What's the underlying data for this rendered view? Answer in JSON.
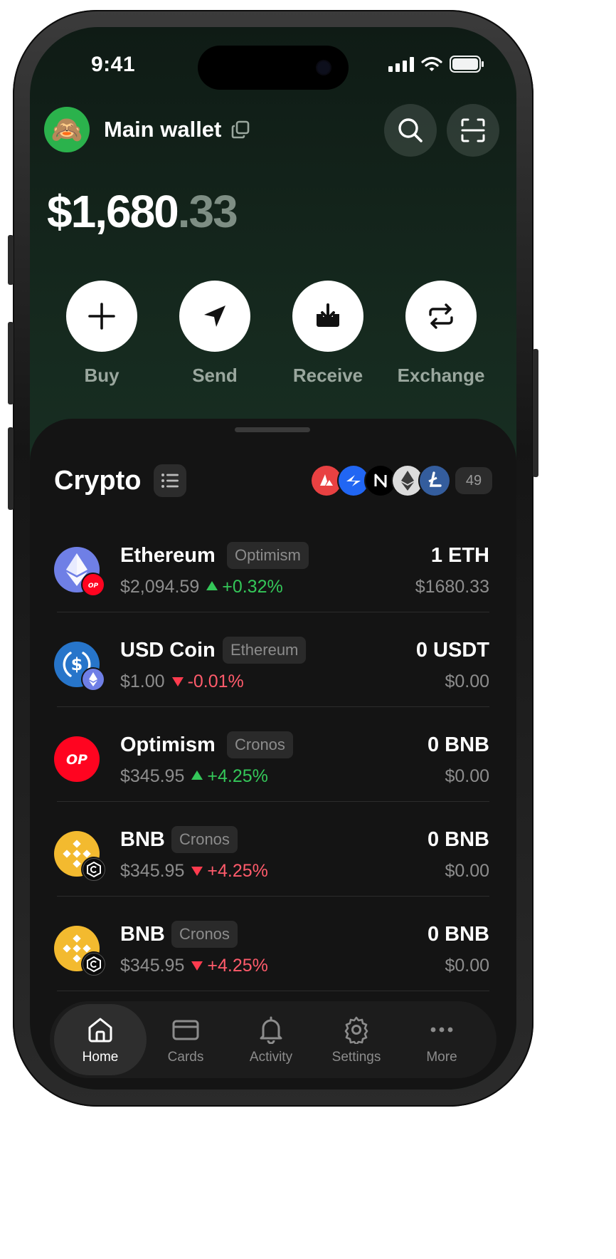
{
  "status_bar": {
    "time": "9:41"
  },
  "header": {
    "avatar_emoji": "🙈",
    "wallet_name": "Main wallet",
    "icons": [
      "copy-icon",
      "search-icon",
      "scan-icon"
    ]
  },
  "balance": {
    "whole": "$1,680",
    "cents": ".33"
  },
  "actions": [
    {
      "label": "Buy",
      "icon": "plus-icon"
    },
    {
      "label": "Send",
      "icon": "send-icon"
    },
    {
      "label": "Receive",
      "icon": "receive-icon"
    },
    {
      "label": "Exchange",
      "icon": "exchange-icon"
    }
  ],
  "crypto": {
    "title": "Crypto",
    "chain_icons": [
      "avalanche-icon",
      "arbitrum-icon",
      "near-icon",
      "ethereum-icon",
      "litecoin-icon"
    ],
    "chain_count": "49"
  },
  "tokens": [
    {
      "name": "Ethereum",
      "network": "Optimism",
      "price": "$2,094.59",
      "direction": "up",
      "change": "+0.32%",
      "amount": "1 ETH",
      "fiat": "$1680.33"
    },
    {
      "name": "USD Coin",
      "network": "Ethereum",
      "price": "$1.00",
      "direction": "down",
      "change": "-0.01%",
      "amount": "0 USDT",
      "fiat": "$0.00"
    },
    {
      "name": "Optimism",
      "network": "Cronos",
      "price": "$345.95",
      "direction": "up",
      "change": "+4.25%",
      "amount": "0 BNB",
      "fiat": "$0.00"
    },
    {
      "name": "BNB",
      "network": "Cronos",
      "price": "$345.95",
      "direction": "down",
      "change": "+4.25%",
      "amount": "0 BNB",
      "fiat": "$0.00"
    },
    {
      "name": "BNB",
      "network": "Cronos",
      "price": "$345.95",
      "direction": "down",
      "change": "+4.25%",
      "amount": "0 BNB",
      "fiat": "$0.00"
    }
  ],
  "tabbar": [
    {
      "label": "Home",
      "icon": "home-icon",
      "active": true
    },
    {
      "label": "Cards",
      "icon": "card-icon",
      "active": false
    },
    {
      "label": "Activity",
      "icon": "bell-icon",
      "active": false
    },
    {
      "label": "Settings",
      "icon": "gear-icon",
      "active": false
    },
    {
      "label": "More",
      "icon": "more-icon",
      "active": false
    }
  ],
  "colors": {
    "accent_green": "#34c759",
    "negative_red": "#ff3b4e",
    "background_dark": "#141414"
  }
}
